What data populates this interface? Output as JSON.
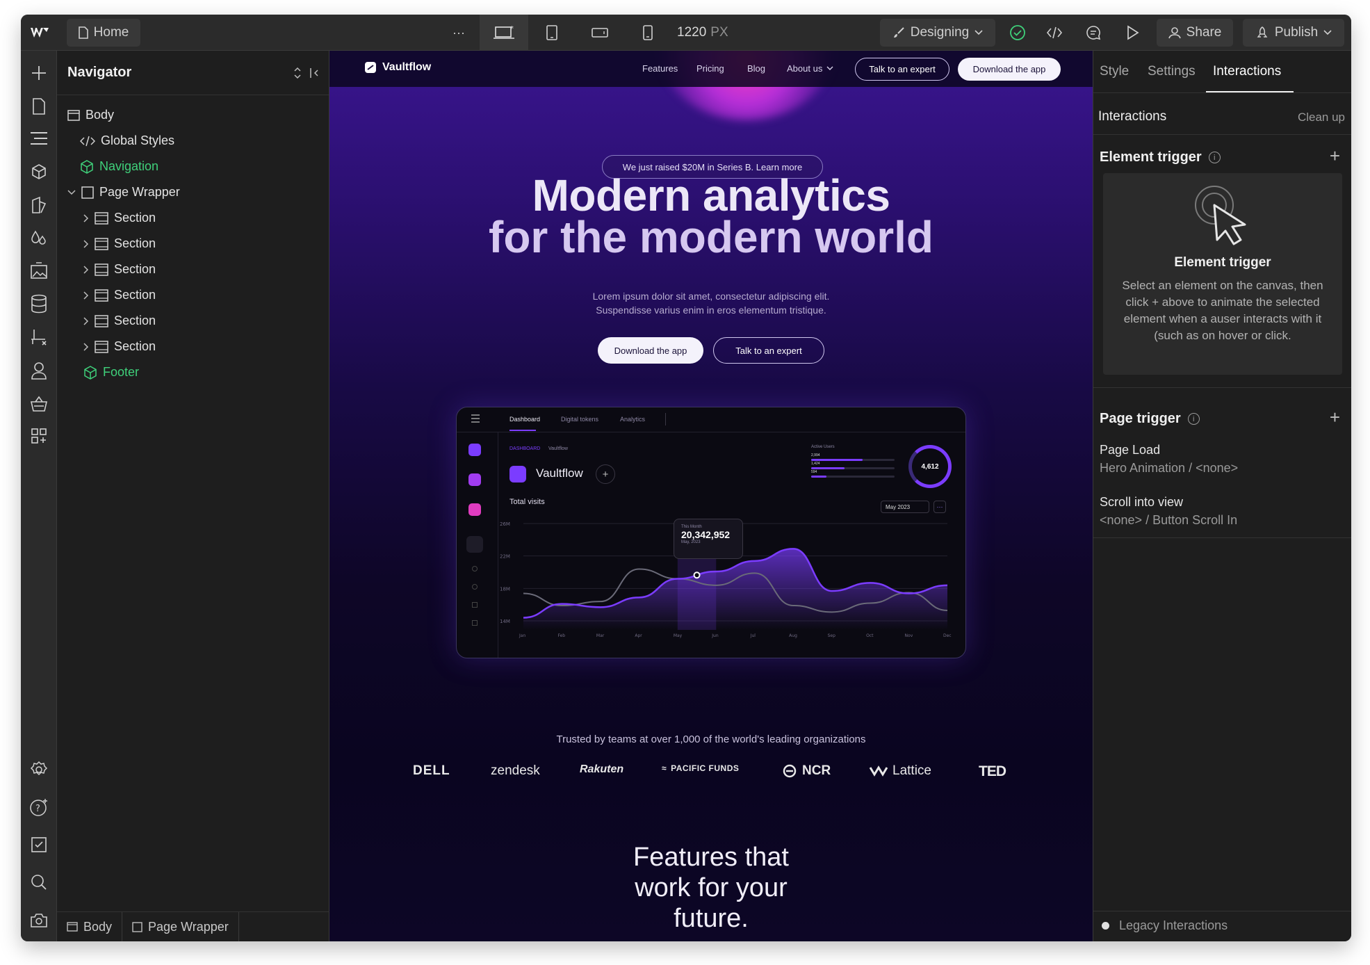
{
  "topbar": {
    "home_label": "Home",
    "more": "···",
    "width_value": "1220",
    "width_unit": "PX",
    "mode_label": "Designing",
    "share_label": "Share",
    "publish_label": "Publish"
  },
  "navigator": {
    "title": "Navigator",
    "tree": {
      "body": "Body",
      "global_styles": "Global Styles",
      "navigation": "Navigation",
      "page_wrapper": "Page Wrapper",
      "sections": [
        "Section",
        "Section",
        "Section",
        "Section",
        "Section",
        "Section"
      ],
      "footer": "Footer"
    },
    "breadcrumb": [
      "Body",
      "Page Wrapper"
    ]
  },
  "site": {
    "brand": "Vaultflow",
    "nav": [
      "Features",
      "Pricing",
      "Blog",
      "About us"
    ],
    "talk_btn": "Talk to an expert",
    "download_btn": "Download the app",
    "announcement": "We just raised $20M in Series B. Learn more",
    "hero_line1": "Modern analytics",
    "hero_line2": "for the modern world",
    "sub_line1": "Lorem ipsum dolor sit amet, consectetur adipiscing elit.",
    "sub_line2": "Suspendisse varius enim in eros elementum tristique.",
    "cta_primary": "Download the app",
    "cta_secondary": "Talk to an expert",
    "trusted": "Trusted by teams at over 1,000 of the world's leading organizations",
    "logos": [
      "DELL",
      "zendesk",
      "Rakuten",
      "PACIFIC FUNDS",
      "NCR",
      "Lattice",
      "TED"
    ],
    "features_heading": [
      "Features that",
      "work for your",
      "future."
    ]
  },
  "dashboard": {
    "tabs": [
      "Dashboard",
      "Digital tokens",
      "Analytics"
    ],
    "breadcrumb": [
      "DASHBOARD",
      "Vaultflow"
    ],
    "title": "Vaultflow",
    "total_visits": "Total visits",
    "active_users_label": "Active Users",
    "user_bars": [
      {
        "label": "2,994",
        "fill": 0.62
      },
      {
        "label": "1,424",
        "fill": 0.4
      },
      {
        "label": "594",
        "fill": 0.18
      }
    ],
    "ring_value": "4,612",
    "date_filter": "May 2023",
    "tooltip_caption": "This Month",
    "tooltip_value": "20,342,952",
    "tooltip_date": "May, 2023"
  },
  "chart_data": {
    "type": "line",
    "x": [
      "Jan",
      "Feb",
      "Mar",
      "Apr",
      "May",
      "Jun",
      "Jul",
      "Aug",
      "Sep",
      "Oct",
      "Nov",
      "Dec"
    ],
    "y_ticks": [
      "26M",
      "22M",
      "18M",
      "14M"
    ],
    "ylim": [
      14,
      26
    ],
    "series": [
      {
        "values": [
          15.5,
          17.2,
          16.8,
          18.0,
          20.3,
          21.2,
          22.5,
          24.0,
          18.8,
          19.8,
          18.5,
          19.5
        ]
      },
      {
        "values": [
          18.5,
          17.0,
          17.5,
          21.5,
          20.3,
          19.5,
          21.0,
          17.0,
          16.2,
          17.3,
          18.6,
          16.4
        ]
      }
    ],
    "highlight": "May",
    "colors": {
      "primary": "#7b3cff",
      "secondary": "#6a6a78"
    }
  },
  "panel": {
    "tabs": [
      "Style",
      "Settings",
      "Interactions"
    ],
    "heading": "Interactions",
    "clean_up": "Clean up",
    "element_trigger": "Element trigger",
    "element_trigger_card_title": "Element trigger",
    "element_trigger_desc": "Select an element on the canvas, then click + above to animate the selected element when a auser interacts with it (such as on hover or click.",
    "page_trigger": "Page trigger",
    "page_load_label": "Page Load",
    "page_load_value": "Hero Animation / <none>",
    "scroll_label": "Scroll into view",
    "scroll_value": "<none> / Button Scroll In",
    "legacy": "Legacy Interactions"
  }
}
